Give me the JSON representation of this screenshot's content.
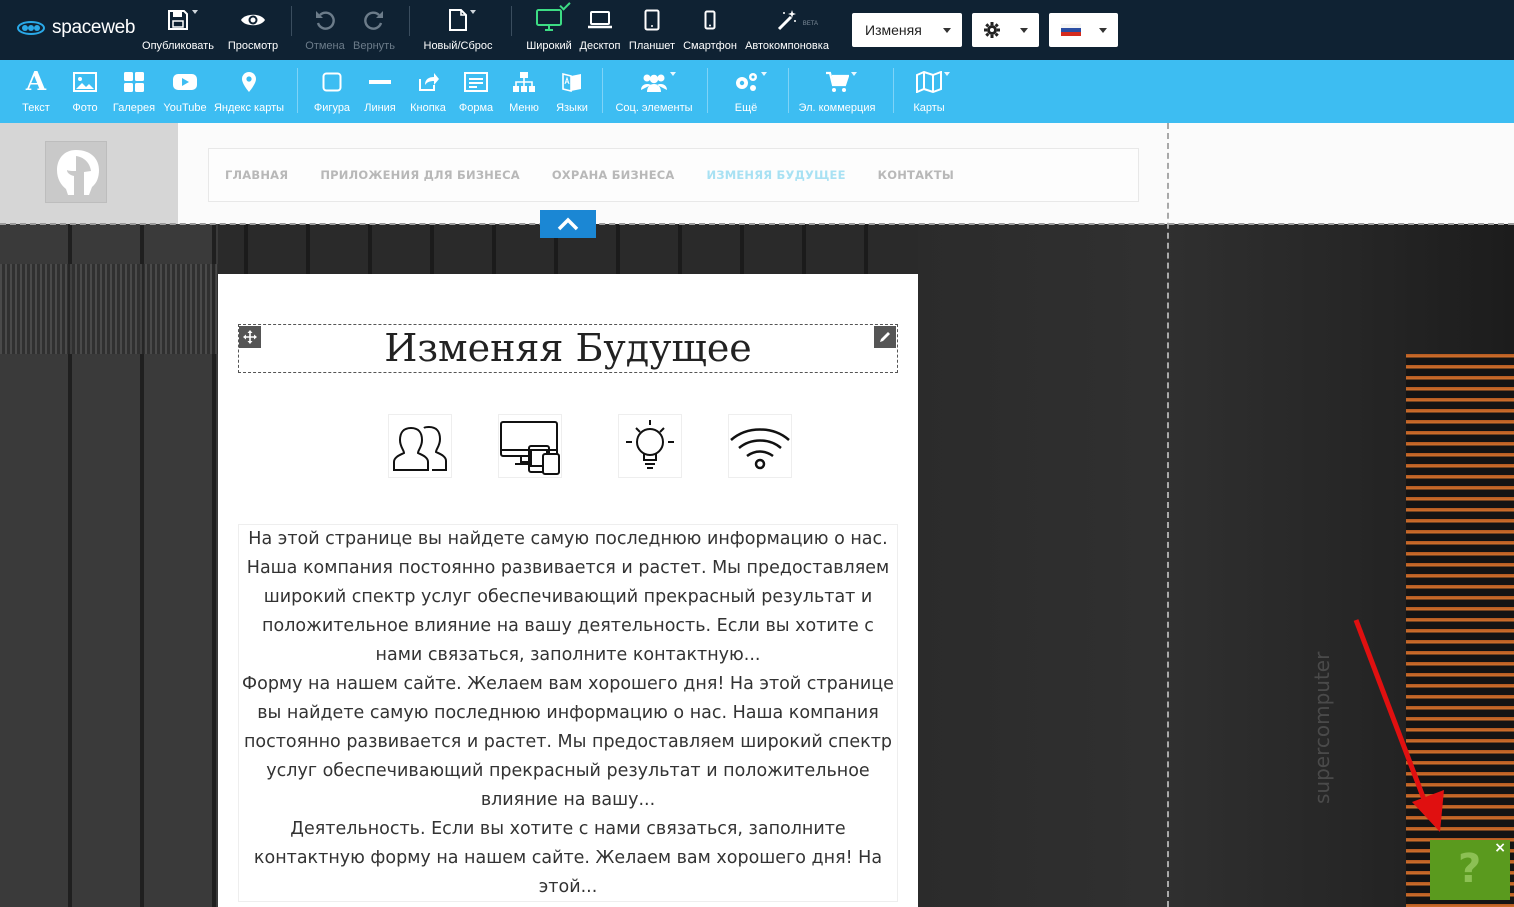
{
  "app": {
    "name": "spaceweb"
  },
  "toolbar": {
    "publish": "Опубликовать",
    "preview": "Просмотр",
    "undo": "Отмена",
    "redo": "Вернуть",
    "new_reset": "Новый/Сброс",
    "wide": "Широкий",
    "desktop": "Десктоп",
    "tablet": "Планшет",
    "smartphone": "Смартфон",
    "autolayout": "Автокомпоновка",
    "beta": "BETA",
    "page_select": "Изменяя",
    "language": "ru"
  },
  "widgets": {
    "text": "Текст",
    "photo": "Фото",
    "gallery": "Галерея",
    "youtube": "YouTube",
    "yandex_maps": "Яндекс карты",
    "shape": "Фигура",
    "line": "Линия",
    "button": "Кнопка",
    "form": "Форма",
    "menu": "Меню",
    "languages": "Языки",
    "social": "Соц. элементы",
    "more": "Ещё",
    "ecommerce": "Эл. коммерция",
    "maps": "Карты"
  },
  "site": {
    "nav": [
      {
        "label": "ГЛАВНАЯ",
        "active": false
      },
      {
        "label": "ПРИЛОЖЕНИЯ ДЛЯ БИЗНЕСА",
        "active": false
      },
      {
        "label": "ОХРАНА БИЗНЕСА",
        "active": false
      },
      {
        "label": "ИЗМЕНЯЯ БУДУЩЕЕ",
        "active": true
      },
      {
        "label": "КОНТАКТЫ",
        "active": false
      }
    ],
    "heading": "Изменяя Будущее",
    "feature_icons": [
      "users-icon",
      "devices-icon",
      "lightbulb-icon",
      "wifi-icon"
    ],
    "paragraphs": [
      "На этой странице вы найдете самую последнюю информацию о нас. Наша компания постоянно развивается и растет. Мы предоставляем широкий спектр услуг обеспечивающий прекрасный результат и положительное влияние на вашу деятельность. Если вы хотите с нами связаться, заполните контактную...",
      "Форму на нашем сайте. Желаем вам хорошего дня! На этой странице вы найдете самую последнюю информацию о нас. Наша компания постоянно развивается и растет. Мы предоставляем широкий спектр услуг обеспечивающий прекрасный результат и положительное влияние на вашу...",
      "Деятельность. Если вы хотите с нами связаться, заполните контактную форму на нашем сайте. Желаем вам хорошего дня! На этой..."
    ],
    "background_text": "supercomputer"
  },
  "help": {
    "label": "?",
    "close": "×"
  },
  "colors": {
    "topbar": "#0f2233",
    "widgetbar": "#3dbdf2",
    "accent_blue": "#1b87d4",
    "active_nav": "#a8e1f3",
    "help_green": "#5a9a1e",
    "arrow_red": "#e01010"
  }
}
